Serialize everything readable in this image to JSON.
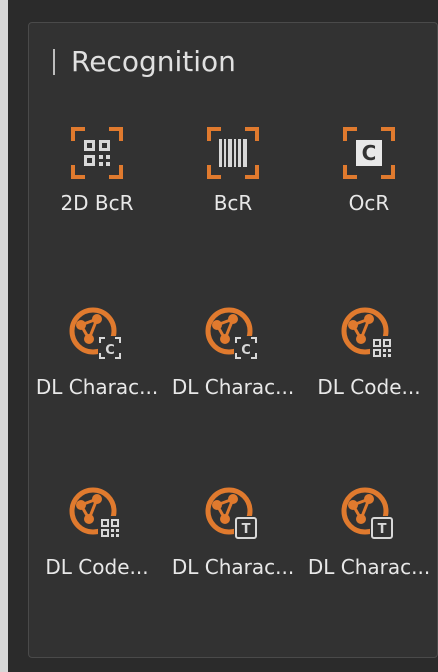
{
  "panel": {
    "title": "Recognition",
    "tools": [
      {
        "label": "2D BcR",
        "icon": "qr-code-icon"
      },
      {
        "label": "BcR",
        "icon": "barcode-icon"
      },
      {
        "label": "OcR",
        "icon": "ocr-c-icon"
      },
      {
        "label": "DL Charac...",
        "icon": "dl-network-c-icon"
      },
      {
        "label": "DL Charac...",
        "icon": "dl-network-c-icon"
      },
      {
        "label": "DL Code...",
        "icon": "dl-network-qr-icon"
      },
      {
        "label": "DL Code...",
        "icon": "dl-network-qr-icon"
      },
      {
        "label": "DL Charac...",
        "icon": "dl-network-t-icon"
      },
      {
        "label": "DL Charac...",
        "icon": "dl-network-t-icon"
      }
    ]
  },
  "colors": {
    "accent": "#e07a2e",
    "background": "#323232",
    "text": "#e8e8e8"
  }
}
